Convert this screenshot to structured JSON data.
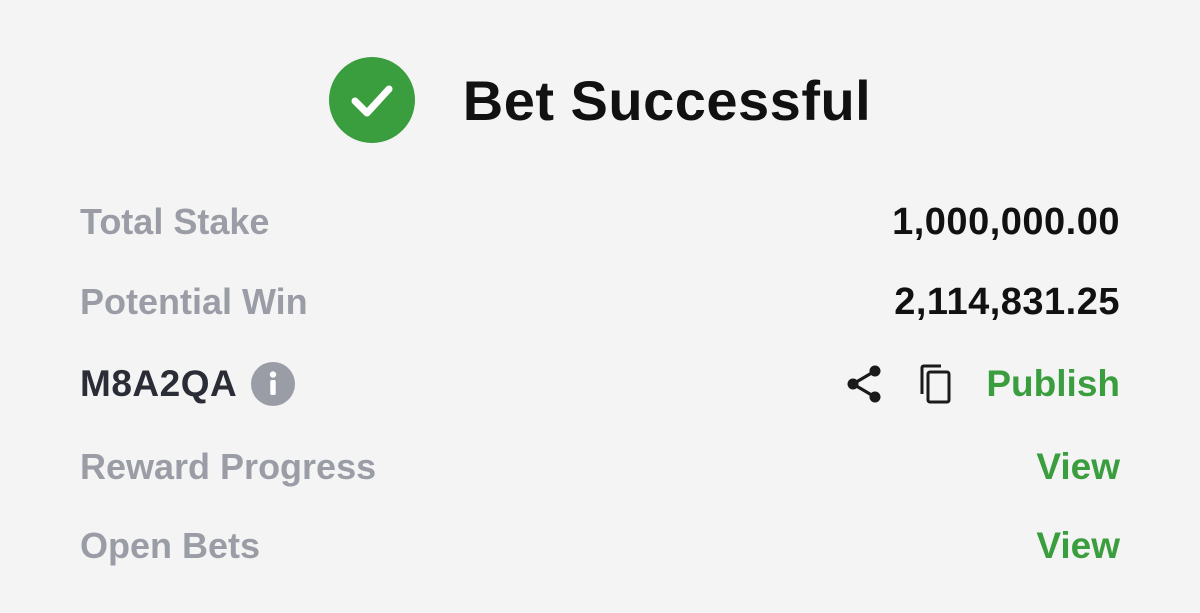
{
  "header": {
    "title": "Bet Successful",
    "status_icon": "check-circle-icon"
  },
  "colors": {
    "success_green": "#3a9d3e",
    "label_gray": "#9a9da6",
    "value_dark": "#111111"
  },
  "summary": {
    "total_stake_label": "Total Stake",
    "total_stake_value": "1,000,000.00",
    "potential_win_label": "Potential Win",
    "potential_win_value": "2,114,831.25"
  },
  "booking": {
    "code": "M8A2QA",
    "info_icon": "info-icon",
    "share_icon": "share-icon",
    "copy_icon": "copy-icon",
    "publish_label": "Publish"
  },
  "links": {
    "reward_progress_label": "Reward Progress",
    "reward_progress_action": "View",
    "open_bets_label": "Open Bets",
    "open_bets_action": "View"
  }
}
